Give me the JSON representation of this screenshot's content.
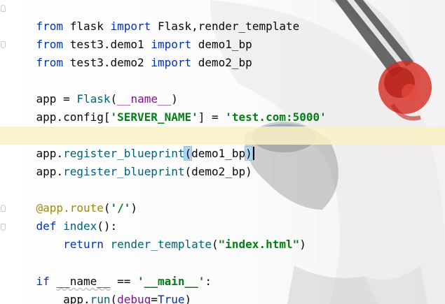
{
  "editor": {
    "lines": [
      {
        "kind": "import",
        "from": "from",
        "module": "flask",
        "import": "import",
        "names": "Flask,render_template"
      },
      {
        "kind": "import",
        "from": "from",
        "module": "test3.demo1",
        "import": "import",
        "names": "demo1_bp"
      },
      {
        "kind": "import",
        "from": "from",
        "module": "test3.demo2",
        "import": "import",
        "names": "demo2_bp"
      },
      {
        "kind": "assign_app",
        "var": "app",
        "eq": "=",
        "cls": "Flask",
        "open": "(",
        "arg": "__name__",
        "close": ")"
      },
      {
        "kind": "config",
        "var": "app",
        "attr": ".config[",
        "key": "'SERVER_NAME'",
        "mid": "] = ",
        "value": "'test.com:5000'"
      },
      {
        "kind": "register",
        "var": "app",
        "dot": ".",
        "method": "register_blueprint",
        "open": "(",
        "arg": "demo1_bp",
        "close": ")"
      },
      {
        "kind": "register",
        "var": "app",
        "dot": ".",
        "method": "register_blueprint",
        "open": "(",
        "arg": "demo2_bp",
        "close": ")"
      },
      {
        "kind": "decorator",
        "text": "@app.route",
        "open": "(",
        "arg": "'/'",
        "close": ")"
      },
      {
        "kind": "def",
        "keyword": "def",
        "name": "index",
        "sig": "():"
      },
      {
        "kind": "return",
        "keyword": "return",
        "call": "render_template",
        "open": "(",
        "arg": "\"index.html\"",
        "close": ")"
      },
      {
        "kind": "if",
        "keyword": "if",
        "left": "__name__",
        "op": "==",
        "right": "'__main__'",
        "colon": ":"
      },
      {
        "kind": "run",
        "var": "app",
        "dot": ".",
        "method": "run",
        "open": "(",
        "param": "debug",
        "eq": "=",
        "value": "True",
        "close": ")"
      }
    ]
  },
  "colors": {
    "keyword": "#0033b3",
    "string": "#067d17",
    "function": "#00627a",
    "parameter": "#871094",
    "decorator": "#9e880d",
    "current_line": "#faf1c4",
    "brace_match": "#aed6f1"
  }
}
